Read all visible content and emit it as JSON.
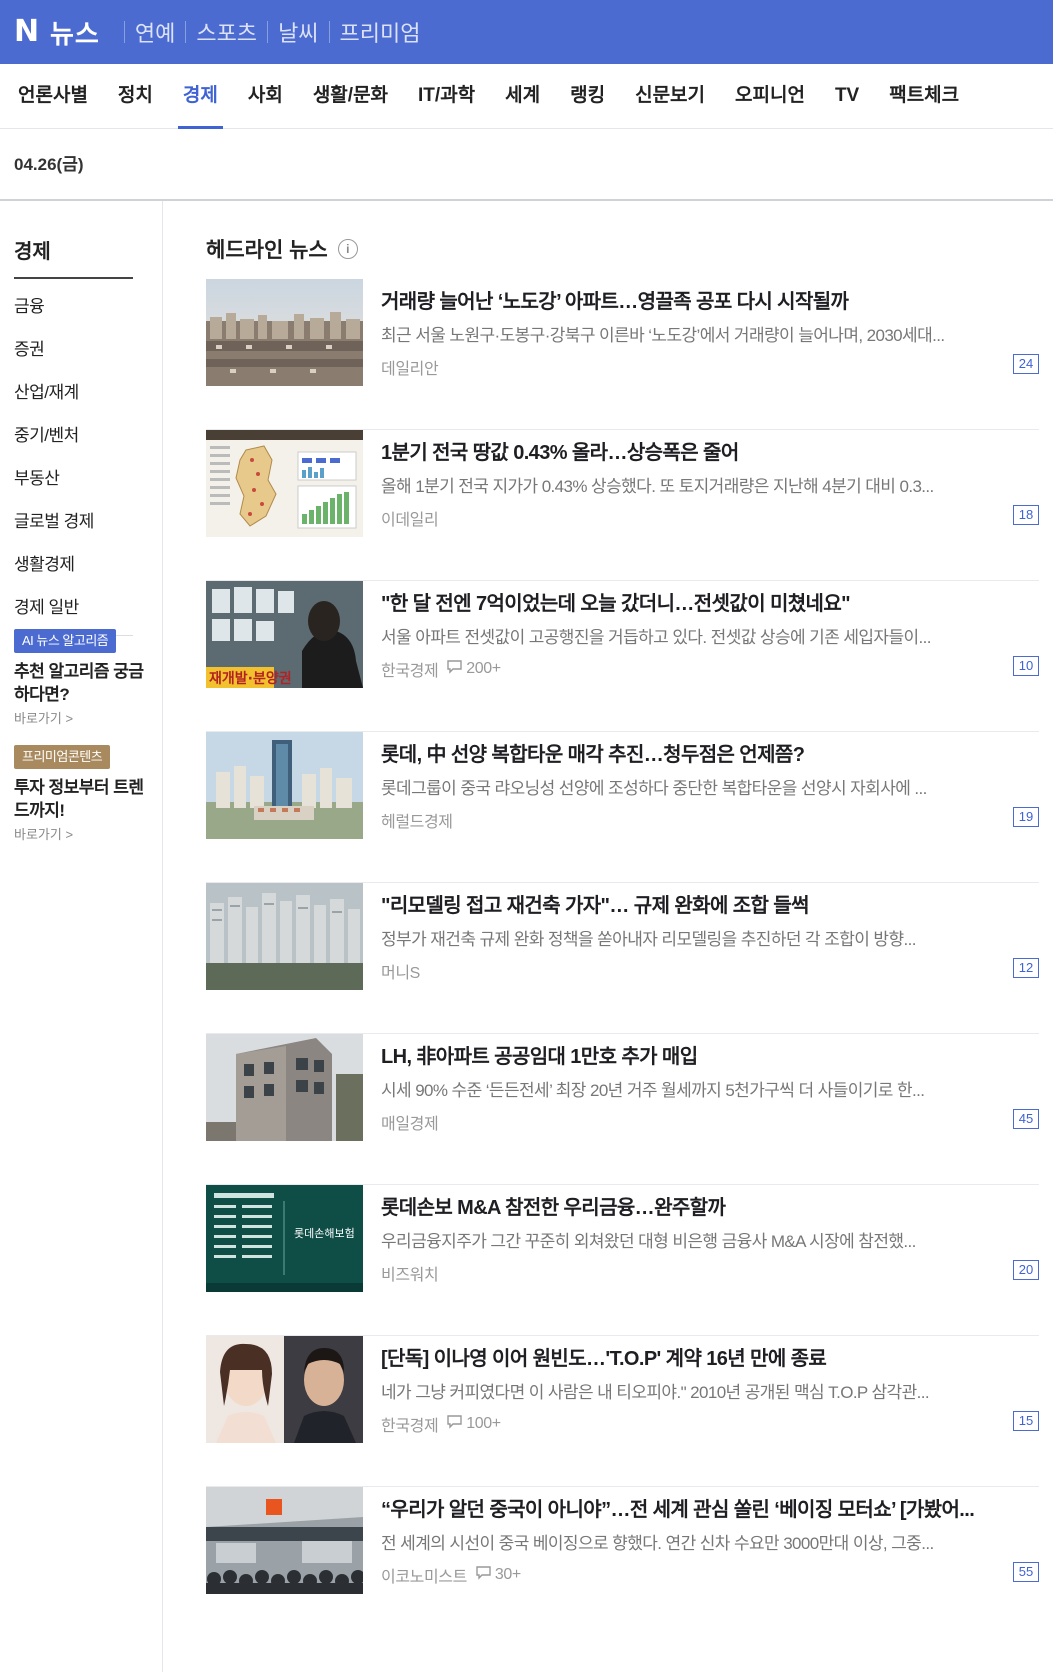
{
  "brand": {
    "logo": "N",
    "name": "뉴스"
  },
  "top_links": [
    "연예",
    "스포츠",
    "날씨",
    "프리미엄"
  ],
  "categories": [
    "언론사별",
    "정치",
    "경제",
    "사회",
    "생활/문화",
    "IT/과학",
    "세계",
    "랭킹",
    "신문보기",
    "오피니언",
    "TV",
    "팩트체크"
  ],
  "active_category": "경제",
  "date": "04.26(금)",
  "sidebar": {
    "title": "경제",
    "items": [
      "금융",
      "증권",
      "산업/재계",
      "중기/벤처",
      "부동산",
      "글로벌 경제",
      "생활경제",
      "경제 일반"
    ],
    "promos": [
      {
        "badge": "AI 뉴스 알고리즘",
        "badge_color": "#4b6bd1",
        "title": "추천 알고리즘 궁금하다면?",
        "link": "바로가기 >"
      },
      {
        "badge": "프리미엄콘텐츠",
        "badge_color": "#a88a5e",
        "title": "투자 정보부터 트렌드까지!",
        "link": "바로가기 >"
      }
    ]
  },
  "section_title": "헤드라인 뉴스",
  "articles": [
    {
      "title": "거래량 늘어난 ‘노도강’ 아파트…영끌족 공포 다시 시작될까",
      "desc": "최근 서울 노원구·도봉구·강북구 이른바 ‘노도강’에서 거래량이 늘어나며, 2030세대...",
      "press": "데일리안",
      "comments": "",
      "count": "24"
    },
    {
      "title": "1분기 전국 땅값 0.43% 올라…상승폭은 줄어",
      "desc": "올해 1분기 전국 지가가 0.43% 상승했다. 또 토지거래량은 지난해 4분기 대비 0.3...",
      "press": "이데일리",
      "comments": "",
      "count": "18"
    },
    {
      "title": "\"한 달 전엔 7억이었는데 오늘 갔더니…전셋값이 미쳤네요\"",
      "desc": "서울 아파트 전셋값이 고공행진을 거듭하고 있다. 전셋값 상승에 기존 세입자들이...",
      "press": "한국경제",
      "comments": "200+",
      "count": "10",
      "thumb_caption": "재개발·분양권"
    },
    {
      "title": "롯데, 中 선양 복합타운 매각 추진…청두점은 언제쯤?",
      "desc": "롯데그룹이 중국 랴오닝성 선양에 조성하다 중단한 복합타운을 선양시 자회사에 ...",
      "press": "헤럴드경제",
      "comments": "",
      "count": "19"
    },
    {
      "title": "\"리모델링 접고 재건축 가자\"… 규제 완화에 조합 들썩",
      "desc": "정부가 재건축 규제 완화 정책을 쏟아내자 리모델링을 추진하던 각 조합이 방향...",
      "press": "머니S",
      "comments": "",
      "count": "12"
    },
    {
      "title": "LH, 非아파트 공공임대 1만호 추가 매입",
      "desc": "시세 90% 수준 ‘든든전세’ 최장 20년 거주 월세까지 5천가구씩 더 사들이기로 한...",
      "press": "매일경제",
      "comments": "",
      "count": "45"
    },
    {
      "title": "롯데손보 M&A 참전한 우리금융…완주할까",
      "desc": "우리금융지주가 그간 꾸준히 외쳐왔던 대형 비은행 금융사 M&A 시장에 참전했...",
      "press": "비즈워치",
      "comments": "",
      "count": "20",
      "thumb_caption": "롯데손해보험"
    },
    {
      "title": "[단독] 이나영 이어 원빈도…'T.O.P' 계약 16년 만에 종료",
      "desc": "네가 그냥 커피였다면 이 사람은 내 티오피야.\" 2010년 공개된 맥심 T.O.P 삼각관...",
      "press": "한국경제",
      "comments": "100+",
      "count": "15"
    },
    {
      "title": "“우리가 알던 중국이 아니야”…전 세계 관심 쏠린 ‘베이징 모터쇼’ [가봤어...",
      "desc": "전 세계의 시선이 중국 베이징으로 향했다. 연간 신차 수요만 3000만대 이상, 그중...",
      "press": "이코노미스트",
      "comments": "30+",
      "count": "55"
    }
  ]
}
